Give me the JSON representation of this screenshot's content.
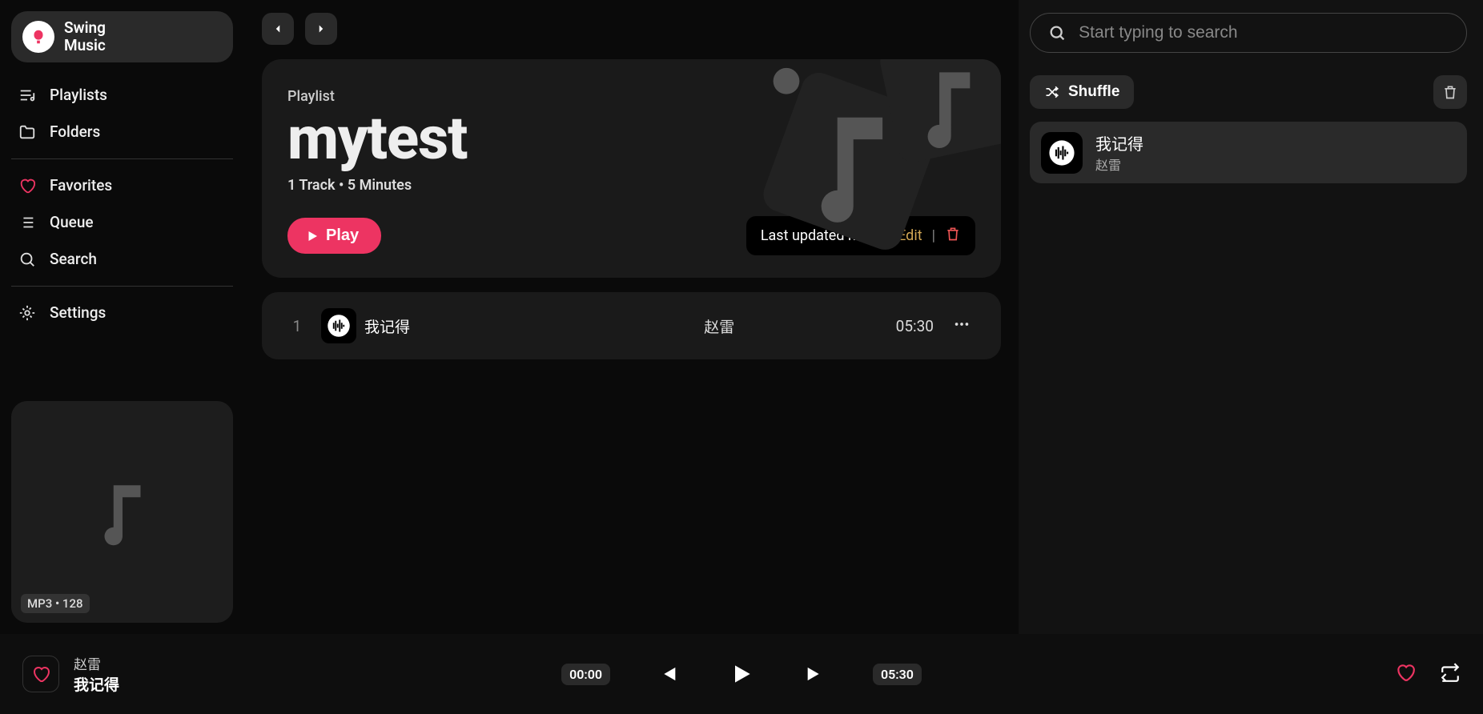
{
  "app": {
    "name_line1": "Swing",
    "name_line2": "Music"
  },
  "sidebar": {
    "items": [
      {
        "label": "Playlists"
      },
      {
        "label": "Folders"
      },
      {
        "label": "Favorites"
      },
      {
        "label": "Queue"
      },
      {
        "label": "Search"
      },
      {
        "label": "Settings"
      }
    ],
    "now_playing_badge": "MP3 • 128"
  },
  "search": {
    "placeholder": "Start typing to search"
  },
  "right_panel": {
    "shuffle_label": "Shuffle",
    "queue": [
      {
        "title": "我记得",
        "artist": "赵雷"
      }
    ]
  },
  "playlist": {
    "subheading": "Playlist",
    "title": "mytest",
    "track_count_text": "1 Track • 5 Minutes",
    "play_label": "Play",
    "last_updated": "Last updated now",
    "edit_label": "Edit",
    "tracks": [
      {
        "num": "1",
        "title": "我记得",
        "artist": "赵雷",
        "duration": "05:30"
      }
    ]
  },
  "player": {
    "artist": "赵雷",
    "title": "我记得",
    "elapsed": "00:00",
    "total": "05:30"
  }
}
